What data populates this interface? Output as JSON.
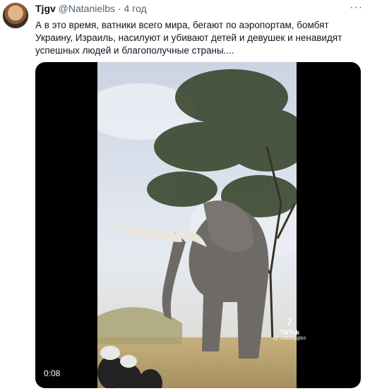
{
  "tweet": {
    "author_name": "Tjgv",
    "handle": "@Natanielbs",
    "separator": "·",
    "time": "4 год",
    "text": "А в это время, ватники всего мира, бегают по аэропортам, бомбят Украину, Израиль, насилуют и убивают детей и девушек и ненавидят успешных людей и благополучные страны....",
    "more_label": "···"
  },
  "video": {
    "timestamp": "0:08",
    "watermark_logo": "♪",
    "watermark_name": "TikTok",
    "watermark_user": "@ usladagglas"
  }
}
